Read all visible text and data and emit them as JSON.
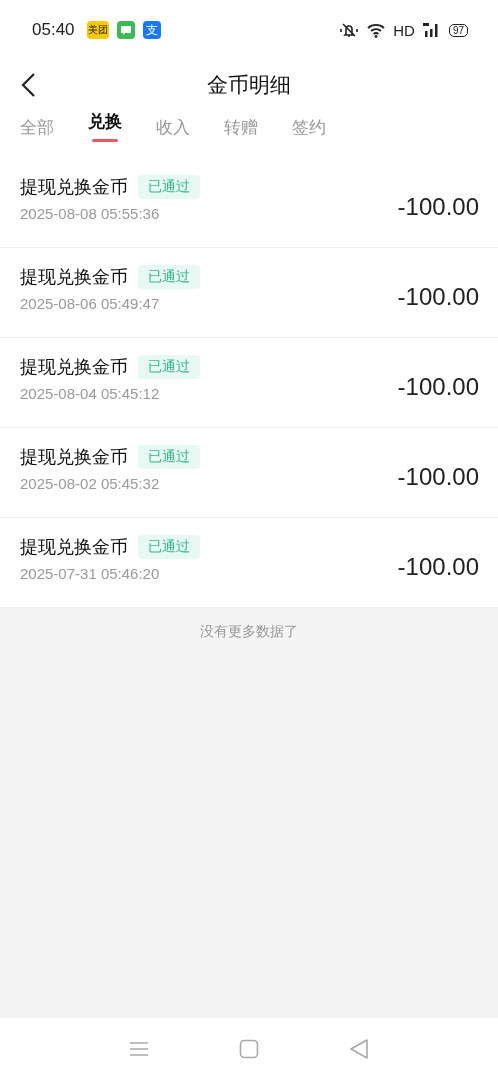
{
  "status_bar": {
    "time": "05:40",
    "app_icons": [
      {
        "kind": "meituan",
        "text": "美团"
      },
      {
        "kind": "message"
      },
      {
        "kind": "alipay",
        "text": "支"
      }
    ],
    "network": "HD",
    "battery": "97"
  },
  "header": {
    "title": "金币明细"
  },
  "tabs": [
    {
      "label": "全部",
      "selected": false
    },
    {
      "label": "兑换",
      "selected": true
    },
    {
      "label": "收入",
      "selected": false
    },
    {
      "label": "转赠",
      "selected": false
    },
    {
      "label": "签约",
      "selected": false
    }
  ],
  "records": [
    {
      "title": "提现兑换金币",
      "status": "已通过",
      "time": "2025-08-08 05:55:36",
      "amount": "-100.00"
    },
    {
      "title": "提现兑换金币",
      "status": "已通过",
      "time": "2025-08-06 05:49:47",
      "amount": "-100.00"
    },
    {
      "title": "提现兑换金币",
      "status": "已通过",
      "time": "2025-08-04 05:45:12",
      "amount": "-100.00"
    },
    {
      "title": "提现兑换金币",
      "status": "已通过",
      "time": "2025-08-02 05:45:32",
      "amount": "-100.00"
    },
    {
      "title": "提现兑换金币",
      "status": "已通过",
      "time": "2025-07-31 05:46:20",
      "amount": "-100.00"
    }
  ],
  "footer_note": "没有更多数据了"
}
